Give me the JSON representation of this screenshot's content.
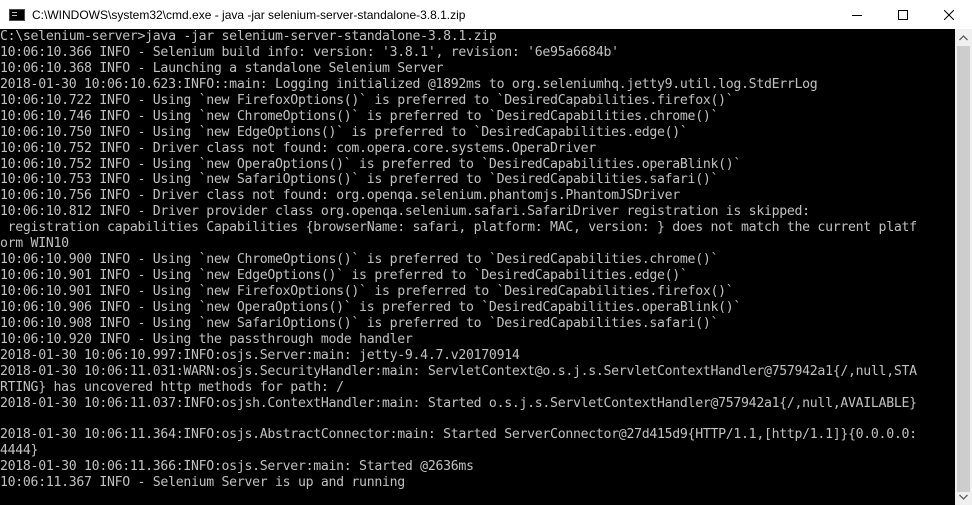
{
  "window": {
    "title": "C:\\WINDOWS\\system32\\cmd.exe - java  -jar selenium-server-standalone-3.8.1.zip"
  },
  "icons": {
    "app": "cmd-icon",
    "minimize": "minimize-icon",
    "maximize": "maximize-icon",
    "close": "close-icon",
    "scroll_up": "chevron-up-icon",
    "scroll_down": "chevron-down-icon"
  },
  "colors": {
    "console_bg": "#000000",
    "console_text": "#c0c0c0",
    "titlebar_bg": "#ffffff"
  },
  "console": {
    "lines": [
      "C:\\selenium-server>java -jar selenium-server-standalone-3.8.1.zip",
      "10:06:10.366 INFO - Selenium build info: version: '3.8.1', revision: '6e95a6684b'",
      "10:06:10.368 INFO - Launching a standalone Selenium Server",
      "2018-01-30 10:06:10.623:INFO::main: Logging initialized @1892ms to org.seleniumhq.jetty9.util.log.StdErrLog",
      "10:06:10.722 INFO - Using `new FirefoxOptions()` is preferred to `DesiredCapabilities.firefox()`",
      "10:06:10.746 INFO - Using `new ChromeOptions()` is preferred to `DesiredCapabilities.chrome()`",
      "10:06:10.750 INFO - Using `new EdgeOptions()` is preferred to `DesiredCapabilities.edge()`",
      "10:06:10.752 INFO - Driver class not found: com.opera.core.systems.OperaDriver",
      "10:06:10.752 INFO - Using `new OperaOptions()` is preferred to `DesiredCapabilities.operaBlink()`",
      "10:06:10.753 INFO - Using `new SafariOptions()` is preferred to `DesiredCapabilities.safari()`",
      "10:06:10.756 INFO - Driver class not found: org.openqa.selenium.phantomjs.PhantomJSDriver",
      "10:06:10.812 INFO - Driver provider class org.openqa.selenium.safari.SafariDriver registration is skipped:",
      " registration capabilities Capabilities {browserName: safari, platform: MAC, version: } does not match the current platf",
      "orm WIN10",
      "10:06:10.900 INFO - Using `new ChromeOptions()` is preferred to `DesiredCapabilities.chrome()`",
      "10:06:10.901 INFO - Using `new EdgeOptions()` is preferred to `DesiredCapabilities.edge()`",
      "10:06:10.901 INFO - Using `new FirefoxOptions()` is preferred to `DesiredCapabilities.firefox()`",
      "10:06:10.906 INFO - Using `new OperaOptions()` is preferred to `DesiredCapabilities.operaBlink()`",
      "10:06:10.908 INFO - Using `new SafariOptions()` is preferred to `DesiredCapabilities.safari()`",
      "10:06:10.920 INFO - Using the passthrough mode handler",
      "2018-01-30 10:06:10.997:INFO:osjs.Server:main: jetty-9.4.7.v20170914",
      "2018-01-30 10:06:11.031:WARN:osjs.SecurityHandler:main: ServletContext@o.s.j.s.ServletContextHandler@757942a1{/,null,STA",
      "RTING} has uncovered http methods for path: /",
      "2018-01-30 10:06:11.037:INFO:osjsh.ContextHandler:main: Started o.s.j.s.ServletContextHandler@757942a1{/,null,AVAILABLE}",
      "",
      "2018-01-30 10:06:11.364:INFO:osjs.AbstractConnector:main: Started ServerConnector@27d415d9{HTTP/1.1,[http/1.1]}{0.0.0.0:",
      "4444}",
      "2018-01-30 10:06:11.366:INFO:osjs.Server:main: Started @2636ms",
      "10:06:11.367 INFO - Selenium Server is up and running"
    ]
  }
}
